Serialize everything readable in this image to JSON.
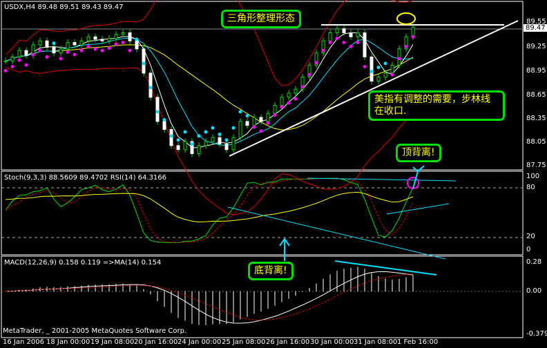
{
  "main": {
    "title": "USDX,H4  89.48 89.51 89.43 89.47",
    "price_ticks": [
      "89.55",
      "89.25",
      "88.95",
      "88.65",
      "88.35",
      "88.05",
      "87.75"
    ],
    "current_price": "89.47"
  },
  "stoch": {
    "title": "Stoch(9,3,3) 88.5609 89.4702  RSI(14) 64.3166",
    "ticks": [
      "100",
      "80",
      "20",
      "0"
    ]
  },
  "macd": {
    "title": "MACD(12,26,9) 0.158 0.119  =>MA(14) 0.154",
    "ticks": [
      "0.28",
      "0.00",
      "-0.379"
    ]
  },
  "copyright": "MetaTrader, _ 2001-2005 MetaQuotes Software Corp.",
  "time_ticks": [
    "16 Jan 2006",
    "18 Jan 00:00",
    "19 Jan 08:00",
    "20 Jan 16:00",
    "24 Jan 00:00",
    "25 Jan 08:00",
    "26 Jan 16:00",
    "30 Jan 00:00",
    "31 Jan 08:00",
    "1 Feb 16:00"
  ],
  "annotations": {
    "triangle": "三角形整理形态",
    "correction": "美指有调整的需要，步林线在收口.",
    "top_divergence": "顶背离!",
    "bottom_divergence": "底背离!"
  },
  "colors": {
    "note_border": "#00e000",
    "note_text": "#ffff00",
    "trendline": "#ffffff",
    "divergence": "#00e0ff",
    "band": "#e00000",
    "sar_up": "#ff00ff",
    "sar_down": "#00e0ff"
  },
  "chart_data": {
    "type": "candlestick",
    "symbol": "USDX",
    "timeframe": "H4",
    "ylim": [
      87.75,
      89.55
    ],
    "closes": [
      89.05,
      89.1,
      89.18,
      89.12,
      89.25,
      89.3,
      89.22,
      89.15,
      89.2,
      89.28,
      89.25,
      89.3,
      89.35,
      89.32,
      89.3,
      89.33,
      89.38,
      89.4,
      89.3,
      89.2,
      88.9,
      88.6,
      88.3,
      88.2,
      88.0,
      87.95,
      88.05,
      87.9,
      88.0,
      88.05,
      88.1,
      88.02,
      87.95,
      88.1,
      88.3,
      88.25,
      88.35,
      88.3,
      88.4,
      88.5,
      88.6,
      88.65,
      88.7,
      88.85,
      89.0,
      89.15,
      89.3,
      89.4,
      89.45,
      89.4,
      89.35,
      89.4,
      89.1,
      88.8,
      88.85,
      88.9,
      89.0,
      89.2,
      89.35,
      89.47
    ]
  }
}
